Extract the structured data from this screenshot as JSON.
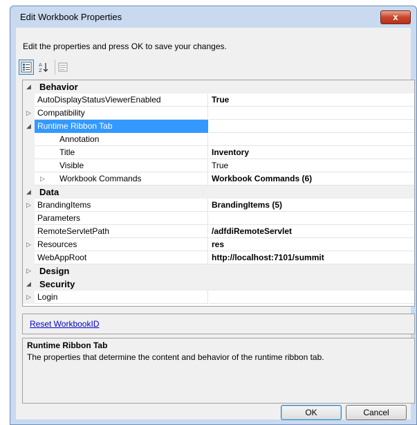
{
  "window": {
    "title": "Edit Workbook Properties",
    "close_label": "x"
  },
  "instruction": "Edit the properties and press OK to save your changes.",
  "toolbar": {
    "icons": [
      "categorized-icon",
      "alphabetical-sort-icon",
      "property-pages-icon"
    ]
  },
  "grid": {
    "rows": [
      {
        "kind": "category",
        "expander": "◢",
        "label": "Behavior",
        "indent": 0
      },
      {
        "kind": "prop",
        "expander": "",
        "label": "AutoDisplayStatusViewerEnabled",
        "value": "True",
        "bold": true,
        "indent": 0
      },
      {
        "kind": "prop",
        "expander": "▷",
        "label": "Compatibility",
        "value": "",
        "bold": false,
        "indent": 0
      },
      {
        "kind": "prop",
        "expander": "◢",
        "label": "Runtime Ribbon Tab",
        "value": "",
        "bold": false,
        "indent": 0,
        "selected": true
      },
      {
        "kind": "prop",
        "expander": "",
        "label": "Annotation",
        "value": "",
        "bold": false,
        "indent": 1
      },
      {
        "kind": "prop",
        "expander": "",
        "label": "Title",
        "value": "Inventory",
        "bold": true,
        "indent": 1
      },
      {
        "kind": "prop",
        "expander": "",
        "label": "Visible",
        "value": "True",
        "bold": false,
        "indent": 1
      },
      {
        "kind": "prop",
        "expander": "▷",
        "label": "Workbook Commands",
        "value": "Workbook Commands (6)",
        "bold": true,
        "indent": 1
      },
      {
        "kind": "category",
        "expander": "◢",
        "label": "Data",
        "indent": 0
      },
      {
        "kind": "prop",
        "expander": "▷",
        "label": "BrandingItems",
        "value": "BrandingItems (5)",
        "bold": true,
        "indent": 0
      },
      {
        "kind": "prop",
        "expander": "",
        "label": "Parameters",
        "value": "",
        "bold": false,
        "indent": 0
      },
      {
        "kind": "prop",
        "expander": "",
        "label": "RemoteServletPath",
        "value": "/adfdiRemoteServlet",
        "bold": true,
        "indent": 0
      },
      {
        "kind": "prop",
        "expander": "▷",
        "label": "Resources",
        "value": "res",
        "bold": true,
        "indent": 0
      },
      {
        "kind": "prop",
        "expander": "",
        "label": "WebAppRoot",
        "value": "http://localhost:7101/summit",
        "bold": true,
        "indent": 0
      },
      {
        "kind": "category",
        "expander": "▷",
        "label": "Design",
        "indent": 0
      },
      {
        "kind": "category",
        "expander": "◢",
        "label": "Security",
        "indent": 0
      },
      {
        "kind": "prop",
        "expander": "▷",
        "label": "Login",
        "value": "",
        "bold": false,
        "indent": 0
      }
    ]
  },
  "reset_link": "Reset WorkbookID",
  "description": {
    "title": "Runtime Ribbon Tab",
    "text": "The properties that determine the content and behavior of the runtime ribbon tab."
  },
  "buttons": {
    "ok": "OK",
    "cancel": "Cancel"
  }
}
